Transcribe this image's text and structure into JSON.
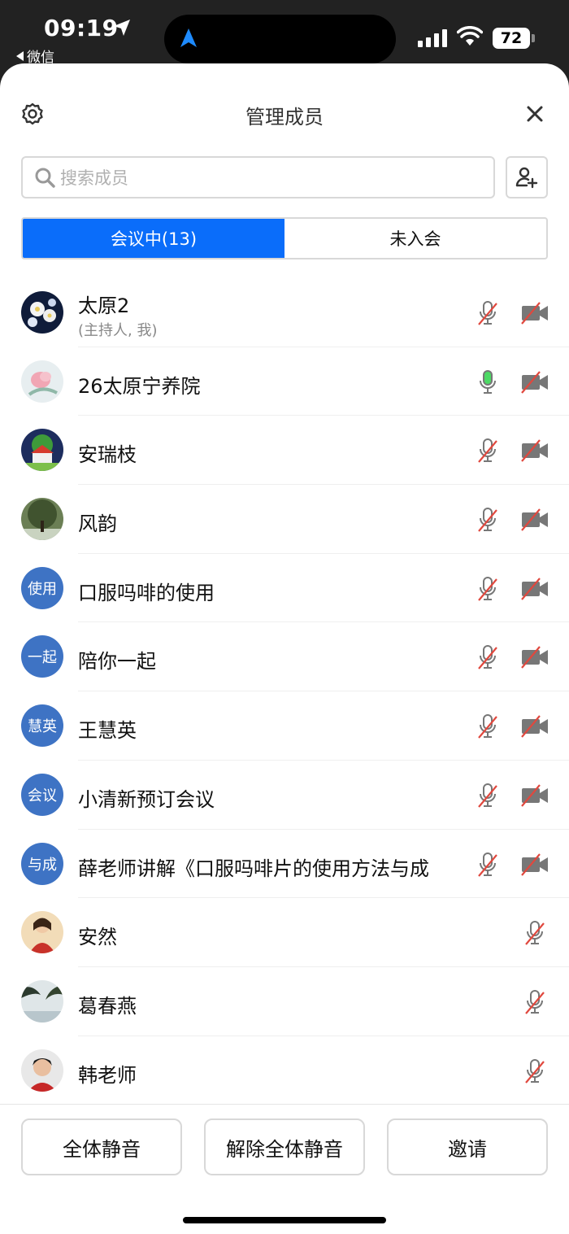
{
  "status": {
    "time": "09:19",
    "back_app": "微信",
    "battery": "72"
  },
  "header": {
    "title": "管理成员"
  },
  "search": {
    "placeholder": "搜索成员"
  },
  "tabs": [
    {
      "label": "会议中(13)",
      "active": true
    },
    {
      "label": "未入会",
      "active": false
    }
  ],
  "members": [
    {
      "name": "太原2",
      "sub": "(主持人, 我)",
      "avatar": "photo-flowers",
      "mic": "muted",
      "camera": "off"
    },
    {
      "name": "26太原宁养院",
      "avatar": "photo-pink-flower",
      "mic": "active",
      "camera": "off"
    },
    {
      "name": "安瑞枝",
      "avatar": "photo-house",
      "mic": "muted",
      "camera": "off"
    },
    {
      "name": "风韵",
      "avatar": "photo-tree",
      "mic": "muted",
      "camera": "off"
    },
    {
      "name": "口服吗啡的使用",
      "avatar_text": "使用",
      "mic": "muted",
      "camera": "off"
    },
    {
      "name": "陪你一起",
      "avatar_text": "一起",
      "mic": "muted",
      "camera": "off"
    },
    {
      "name": "王慧英",
      "avatar_text": "慧英",
      "mic": "muted",
      "camera": "off"
    },
    {
      "name": "小清新预订会议",
      "avatar_text": "会议",
      "mic": "muted",
      "camera": "off"
    },
    {
      "name": "薛老师讲解《口服吗啡片的使用方法与成",
      "avatar_text": "与成",
      "mic": "muted",
      "camera": "off"
    },
    {
      "name": "安然",
      "avatar": "photo-girl",
      "mic": "muted"
    },
    {
      "name": "葛春燕",
      "avatar": "photo-palm",
      "mic": "muted"
    },
    {
      "name": "韩老师",
      "avatar": "photo-man",
      "mic": "muted"
    }
  ],
  "bottom": {
    "mute_all": "全体静音",
    "unmute_all": "解除全体静音",
    "invite": "邀请"
  },
  "colors": {
    "accent": "#0a6dfa",
    "avatar_bg": "#3e73c4",
    "mic_active": "#4cd964",
    "mute_slash": "#e0483e"
  }
}
